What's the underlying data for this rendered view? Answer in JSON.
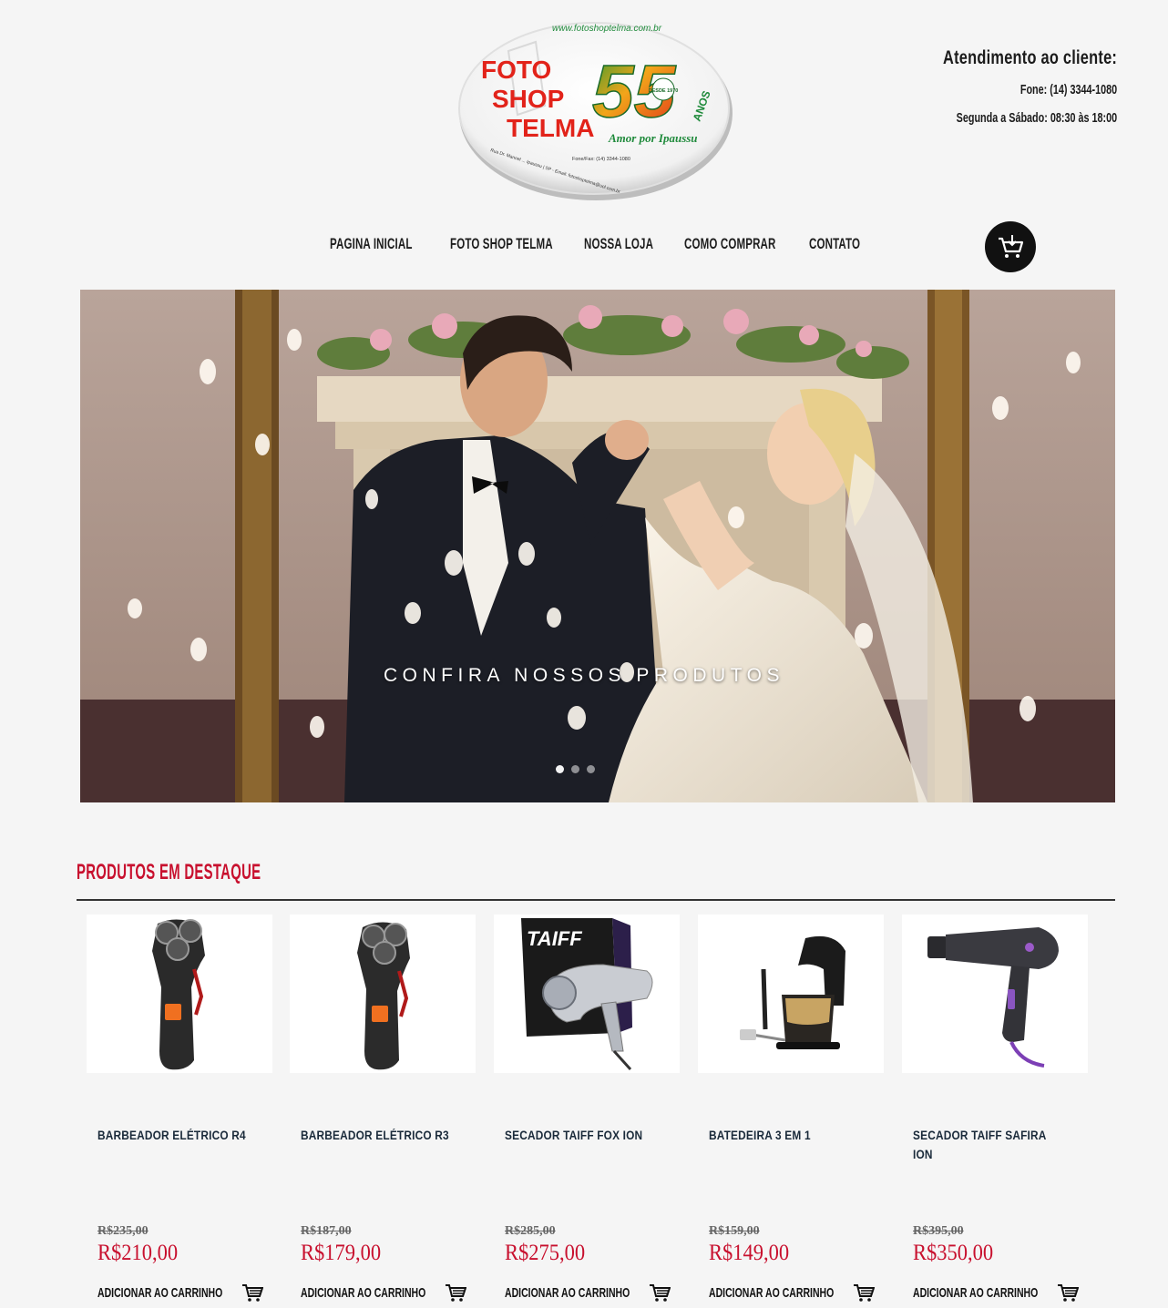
{
  "header": {
    "logo": {
      "url_text": "www.fotoshoptelma.com.br",
      "line1": "FOTO",
      "line2": "SHOP",
      "line3": "TELMA",
      "years": "55",
      "years_word": "ANOS",
      "tagline": "Amor por Ipaussu",
      "since": "DESDE 1970",
      "contact_line": "Fone/Fax: (14) 3344-1080",
      "address_line": "Rua Dr. Manoel ... Ipaussu | SP - Email: fotoshoptelma@uol.com.br"
    },
    "support": {
      "title": "Atendimento ao cliente:",
      "phone": "Fone: (14) 3344-1080",
      "hours": "Segunda a Sábado: 08:30 às 18:00"
    }
  },
  "nav": {
    "items": [
      {
        "label": "PAGINA INICIAL"
      },
      {
        "label": "FOTO SHOP TELMA"
      },
      {
        "label": "NOSSA LOJA"
      },
      {
        "label": "COMO COMPRAR"
      },
      {
        "label": "CONTATO"
      }
    ],
    "cart_icon": "shopping-cart-icon"
  },
  "hero": {
    "caption": "CONFIRA NOSSOS PRODUTOS",
    "active_slide": 0,
    "slide_count": 3
  },
  "featured": {
    "title": "PRODUTOS EM DESTAQUE",
    "add_to_cart_label": "ADICIONAR AO CARRINHO",
    "products": [
      {
        "name": "BARBEADOR ELÉTRICO R4",
        "old_price": "R$235,00",
        "price": "R$210,00",
        "image": "electric-shaver"
      },
      {
        "name": "BARBEADOR ELÉTRICO R3",
        "old_price": "R$187,00",
        "price": "R$179,00",
        "image": "electric-shaver"
      },
      {
        "name": "SECADOR TAIFF FOX ION",
        "old_price": "R$285,00",
        "price": "R$275,00",
        "image": "hair-dryer-box",
        "box_text": "TAIFF"
      },
      {
        "name": "BATEDEIRA 3 EM 1",
        "old_price": "R$159,00",
        "price": "R$149,00",
        "image": "stand-mixer"
      },
      {
        "name": "SECADOR TAIFF SAFIRA ION",
        "old_price": "R$395,00",
        "price": "R$350,00",
        "image": "hair-dryer"
      }
    ]
  },
  "colors": {
    "accent_red": "#c8102e",
    "background": "#f5f5f5",
    "text_dark": "#1b1b1b"
  }
}
